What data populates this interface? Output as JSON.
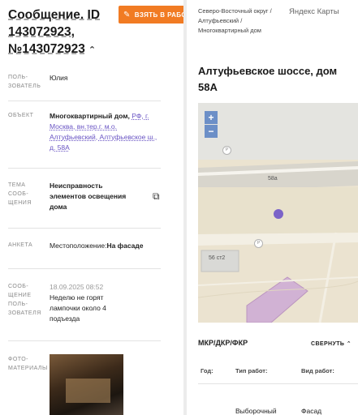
{
  "left": {
    "title": "Сообщение. ID 143072923, №143072923",
    "take_button": "ВЗЯТЬ В РАБОТУ",
    "fields": {
      "author_label": "ПОЛЬ-ЗОВАТЕЛЬ",
      "author_value": "Юлия",
      "object_label": "ОБЪЕКТ",
      "object_type": "Многоквартирный дом,",
      "object_address": "РФ, г. Москва, вн.тер.г. м.о. Алтуфьевский, Алтуфьевское ш., д. 58А",
      "topic_label": "ТЕМА СООБ-ЩЕНИЯ",
      "topic_value": "Неисправность элементов освещения дома",
      "form_label": "АНКЕТА",
      "form_key": "Местоположение:",
      "form_value": "На фасаде",
      "message_label": "СООБ-ЩЕНИЕ ПОЛЬ-ЗОВАТЕЛЯ",
      "message_date": "18.09.2025 08:52",
      "message_text": "Неделю не горят лампочки около 4 подъезда",
      "photos_label": "ФОТО-МАТЕРИАЛЫ"
    }
  },
  "right": {
    "breadcrumb": "Северо-Восточный округ / Алтуфьевский / Многоквартирный дом",
    "map_provider": "Яндекс Карты",
    "address": "Алтуфьевское шоссе, дом 58А",
    "map": {
      "zoom_in": "+",
      "zoom_out": "−",
      "house_label": "58а",
      "building_label": "56 ст2"
    },
    "works": {
      "title": "МКР/ДКР/ФКР",
      "collapse": "СВЕРНУТЬ",
      "col_year": "Год:",
      "col_type": "Тип работ:",
      "col_kind": "Вид работ:",
      "row_type": "Выборочный",
      "row_kind": "Фасад"
    }
  },
  "colors": {
    "accent_orange": "#f17b23",
    "link_purple": "#6a55c4",
    "marker_purple": "#7b63c8",
    "zoom_blue": "#6c8fc7"
  }
}
